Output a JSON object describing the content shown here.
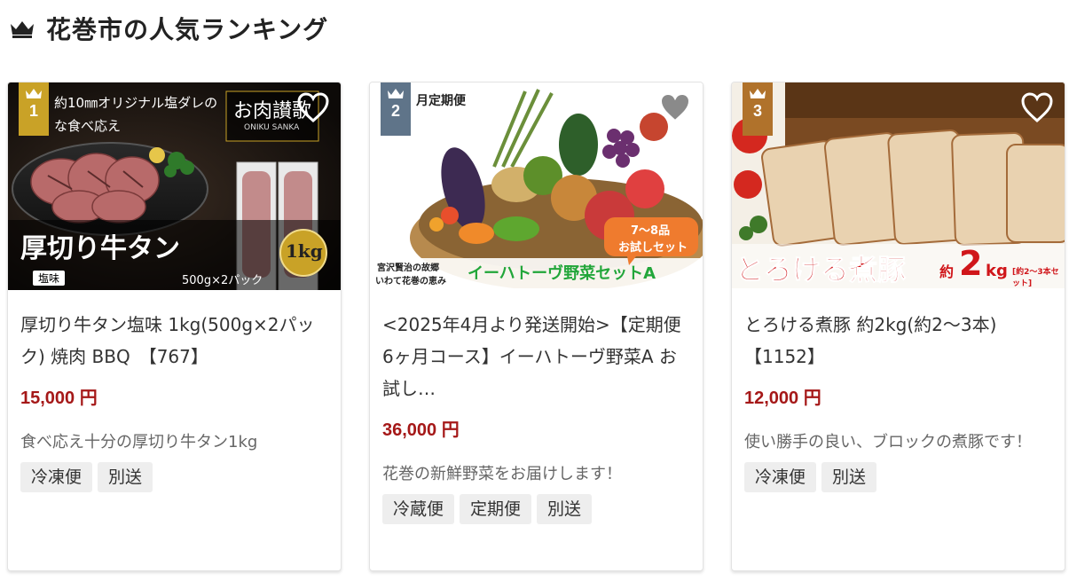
{
  "header": {
    "title": "花巻市の人気ランキング",
    "icon": "crown-icon"
  },
  "products": [
    {
      "rank": "1",
      "rank_color": "#c9a227",
      "title": "厚切り牛タン塩味 1kg(500g×2パック) 焼肉 BBQ　【767】",
      "price": "15,000 円",
      "description": "食べ応え十分の厚切り牛タン1kg",
      "tags": [
        "冷凍便",
        "別送"
      ],
      "image": {
        "top_text": "約10㎜オリジナル塩ダレの",
        "top_text2": "な食べ応え",
        "brand": "お肉讃歌",
        "brand_sub": "ONIKU SANKA",
        "headline": "厚切り牛タン",
        "badge_weight": "1kg",
        "flavor": "塩味",
        "pack": "500g×2パック"
      }
    },
    {
      "rank": "2",
      "rank_color": "#5f7489",
      "title": "<2025年4月より発送開始>【定期便6ヶ月コース】イーハトーヴ野菜A お試し…",
      "price": "36,000 円",
      "description": "花巻の新鮮野菜をお届けします！",
      "tags": [
        "冷蔵便",
        "定期便",
        "別送"
      ],
      "image": {
        "top_text": "月定期便",
        "bubble_line1": "7～8品",
        "bubble_line2": "お試しセット",
        "origin_line1": "宮沢賢治の故郷",
        "origin_line2": "いわて花巻の恵み",
        "headline": "イーハトーヴ野菜セットA"
      }
    },
    {
      "rank": "3",
      "rank_color": "#b0722b",
      "title": "とろける煮豚 約2kg(約2～3本)【1152】",
      "price": "12,000 円",
      "description": "使い勝手の良い、ブロックの煮豚です！",
      "tags": [
        "冷凍便",
        "別送"
      ],
      "image": {
        "headline": "とろける煮豚",
        "approx": "約",
        "weight": "2",
        "unit": "kg",
        "note": "[約2～3本セット]"
      }
    }
  ]
}
